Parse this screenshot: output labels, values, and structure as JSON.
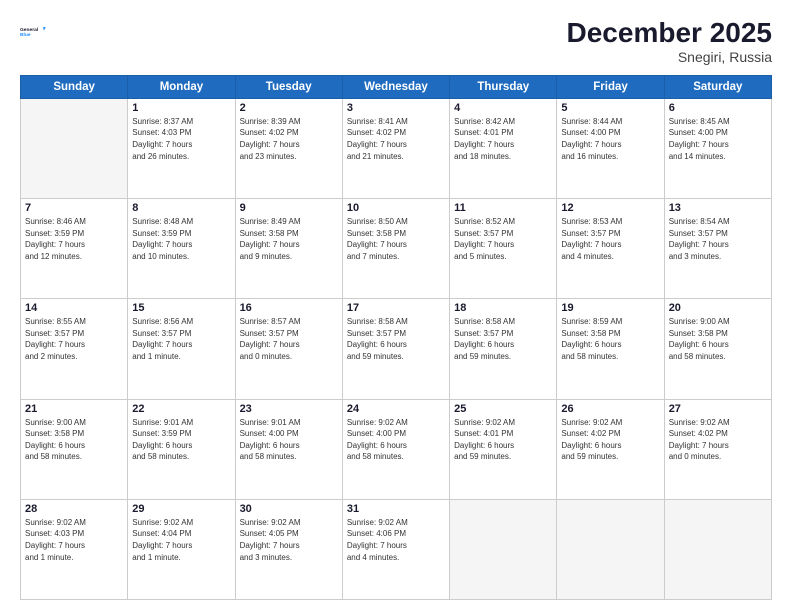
{
  "header": {
    "logo_line1": "General",
    "logo_line2": "Blue",
    "month_year": "December 2025",
    "location": "Snegiri, Russia"
  },
  "weekdays": [
    "Sunday",
    "Monday",
    "Tuesday",
    "Wednesday",
    "Thursday",
    "Friday",
    "Saturday"
  ],
  "weeks": [
    [
      {
        "day": "",
        "info": ""
      },
      {
        "day": "1",
        "info": "Sunrise: 8:37 AM\nSunset: 4:03 PM\nDaylight: 7 hours\nand 26 minutes."
      },
      {
        "day": "2",
        "info": "Sunrise: 8:39 AM\nSunset: 4:02 PM\nDaylight: 7 hours\nand 23 minutes."
      },
      {
        "day": "3",
        "info": "Sunrise: 8:41 AM\nSunset: 4:02 PM\nDaylight: 7 hours\nand 21 minutes."
      },
      {
        "day": "4",
        "info": "Sunrise: 8:42 AM\nSunset: 4:01 PM\nDaylight: 7 hours\nand 18 minutes."
      },
      {
        "day": "5",
        "info": "Sunrise: 8:44 AM\nSunset: 4:00 PM\nDaylight: 7 hours\nand 16 minutes."
      },
      {
        "day": "6",
        "info": "Sunrise: 8:45 AM\nSunset: 4:00 PM\nDaylight: 7 hours\nand 14 minutes."
      }
    ],
    [
      {
        "day": "7",
        "info": "Sunrise: 8:46 AM\nSunset: 3:59 PM\nDaylight: 7 hours\nand 12 minutes."
      },
      {
        "day": "8",
        "info": "Sunrise: 8:48 AM\nSunset: 3:59 PM\nDaylight: 7 hours\nand 10 minutes."
      },
      {
        "day": "9",
        "info": "Sunrise: 8:49 AM\nSunset: 3:58 PM\nDaylight: 7 hours\nand 9 minutes."
      },
      {
        "day": "10",
        "info": "Sunrise: 8:50 AM\nSunset: 3:58 PM\nDaylight: 7 hours\nand 7 minutes."
      },
      {
        "day": "11",
        "info": "Sunrise: 8:52 AM\nSunset: 3:57 PM\nDaylight: 7 hours\nand 5 minutes."
      },
      {
        "day": "12",
        "info": "Sunrise: 8:53 AM\nSunset: 3:57 PM\nDaylight: 7 hours\nand 4 minutes."
      },
      {
        "day": "13",
        "info": "Sunrise: 8:54 AM\nSunset: 3:57 PM\nDaylight: 7 hours\nand 3 minutes."
      }
    ],
    [
      {
        "day": "14",
        "info": "Sunrise: 8:55 AM\nSunset: 3:57 PM\nDaylight: 7 hours\nand 2 minutes."
      },
      {
        "day": "15",
        "info": "Sunrise: 8:56 AM\nSunset: 3:57 PM\nDaylight: 7 hours\nand 1 minute."
      },
      {
        "day": "16",
        "info": "Sunrise: 8:57 AM\nSunset: 3:57 PM\nDaylight: 7 hours\nand 0 minutes."
      },
      {
        "day": "17",
        "info": "Sunrise: 8:58 AM\nSunset: 3:57 PM\nDaylight: 6 hours\nand 59 minutes."
      },
      {
        "day": "18",
        "info": "Sunrise: 8:58 AM\nSunset: 3:57 PM\nDaylight: 6 hours\nand 59 minutes."
      },
      {
        "day": "19",
        "info": "Sunrise: 8:59 AM\nSunset: 3:58 PM\nDaylight: 6 hours\nand 58 minutes."
      },
      {
        "day": "20",
        "info": "Sunrise: 9:00 AM\nSunset: 3:58 PM\nDaylight: 6 hours\nand 58 minutes."
      }
    ],
    [
      {
        "day": "21",
        "info": "Sunrise: 9:00 AM\nSunset: 3:58 PM\nDaylight: 6 hours\nand 58 minutes."
      },
      {
        "day": "22",
        "info": "Sunrise: 9:01 AM\nSunset: 3:59 PM\nDaylight: 6 hours\nand 58 minutes."
      },
      {
        "day": "23",
        "info": "Sunrise: 9:01 AM\nSunset: 4:00 PM\nDaylight: 6 hours\nand 58 minutes."
      },
      {
        "day": "24",
        "info": "Sunrise: 9:02 AM\nSunset: 4:00 PM\nDaylight: 6 hours\nand 58 minutes."
      },
      {
        "day": "25",
        "info": "Sunrise: 9:02 AM\nSunset: 4:01 PM\nDaylight: 6 hours\nand 59 minutes."
      },
      {
        "day": "26",
        "info": "Sunrise: 9:02 AM\nSunset: 4:02 PM\nDaylight: 6 hours\nand 59 minutes."
      },
      {
        "day": "27",
        "info": "Sunrise: 9:02 AM\nSunset: 4:02 PM\nDaylight: 7 hours\nand 0 minutes."
      }
    ],
    [
      {
        "day": "28",
        "info": "Sunrise: 9:02 AM\nSunset: 4:03 PM\nDaylight: 7 hours\nand 1 minute."
      },
      {
        "day": "29",
        "info": "Sunrise: 9:02 AM\nSunset: 4:04 PM\nDaylight: 7 hours\nand 1 minute."
      },
      {
        "day": "30",
        "info": "Sunrise: 9:02 AM\nSunset: 4:05 PM\nDaylight: 7 hours\nand 3 minutes."
      },
      {
        "day": "31",
        "info": "Sunrise: 9:02 AM\nSunset: 4:06 PM\nDaylight: 7 hours\nand 4 minutes."
      },
      {
        "day": "",
        "info": ""
      },
      {
        "day": "",
        "info": ""
      },
      {
        "day": "",
        "info": ""
      }
    ]
  ]
}
